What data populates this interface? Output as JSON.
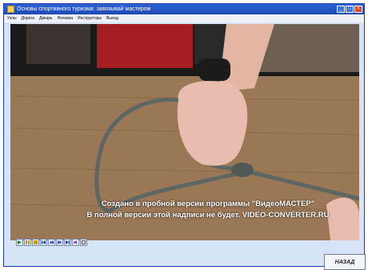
{
  "window": {
    "title": "Основы спортивного туризма: завязывай мастером"
  },
  "menu": [
    "Узлы",
    "Дорога",
    "Дикарь",
    "Ночевка",
    "Инструкторы",
    "Выход"
  ],
  "watermark": {
    "line1": "Создано в пробной версии программы \"ВидеоМАСТЕР\"",
    "line2": "В полной версии этой надписи не будет. VIDEO-CONVERTER.RU"
  },
  "controls": [
    "play-icon",
    "pause-icon",
    "stop-icon",
    "skip-start-icon",
    "rewind-icon",
    "forward-icon",
    "skip-end-icon",
    "volume-icon",
    "fullscreen-icon"
  ],
  "back_button": {
    "label": "НАЗАД"
  }
}
